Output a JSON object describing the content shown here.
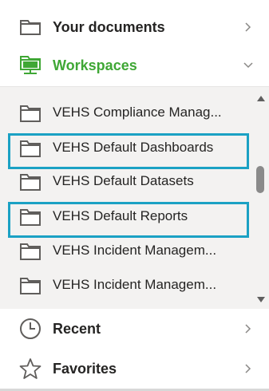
{
  "nav": {
    "your_documents": {
      "label": "Your documents",
      "icon": "folder-icon"
    },
    "workspaces": {
      "label": "Workspaces",
      "icon": "workspace-icon",
      "expanded": true,
      "accent_color": "#3fa735"
    },
    "recent": {
      "label": "Recent",
      "icon": "clock-icon"
    },
    "favorites": {
      "label": "Favorites",
      "icon": "star-icon"
    }
  },
  "workspaces": {
    "items": [
      {
        "label": "VEHS Compliance Manag...",
        "highlighted": false
      },
      {
        "label": "VEHS Default Dashboards",
        "highlighted": true
      },
      {
        "label": "VEHS Default Datasets",
        "highlighted": false
      },
      {
        "label": "VEHS Default Reports",
        "highlighted": true
      },
      {
        "label": "VEHS Incident Managem...",
        "highlighted": false
      },
      {
        "label": "VEHS Incident Managem...",
        "highlighted": false
      }
    ],
    "highlight_color": "#1ba1c4"
  }
}
